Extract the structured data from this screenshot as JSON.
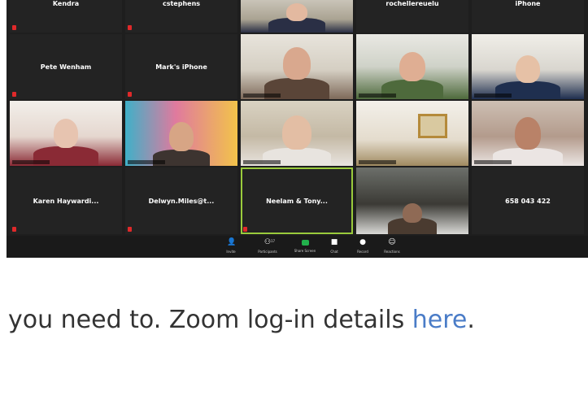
{
  "participants": {
    "row1": [
      "Kendra",
      "cstephens",
      "",
      "rochellereuelu",
      "iPhone"
    ],
    "row2": [
      "Pete Wenham",
      "Mark's iPhone"
    ],
    "row4": [
      "Karen Haywardi...",
      "Delwyn.Miles@t...",
      "Neelam & Tony...",
      "",
      "658 043 422"
    ]
  },
  "toolbar": {
    "invite": "Invite",
    "participants": "Participants",
    "participants_count": "17",
    "share": "Share Screen",
    "chat": "Chat",
    "record": "Record",
    "reactions": "Reactions"
  },
  "body_text": {
    "prefix": "you need to. Zoom log-in details ",
    "link": "here",
    "suffix": "."
  },
  "colors": {
    "mic_muted": "#e0292a",
    "active_speaker": "#9acb3c",
    "link": "#4a7cc7"
  }
}
